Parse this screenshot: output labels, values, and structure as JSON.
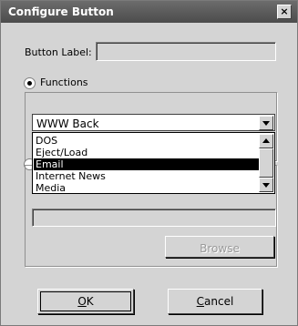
{
  "window": {
    "title": "Configure Button",
    "close_glyph": "×"
  },
  "button_label": {
    "label": "Button Label:",
    "value": ""
  },
  "functions_radio": {
    "label": "Functions",
    "selected": true
  },
  "functions_combo": {
    "selected": "WWW Back",
    "options": [
      "DOS",
      "Eject/Load",
      "Email",
      "Internet News",
      "Media"
    ],
    "highlighted": "Email"
  },
  "path_field": {
    "value": ""
  },
  "browse_button": {
    "label": "Browse",
    "enabled": false
  },
  "ok_button": {
    "label": "OK",
    "mnemonic": "O"
  },
  "cancel_button": {
    "label": "Cancel",
    "mnemonic": "C"
  }
}
